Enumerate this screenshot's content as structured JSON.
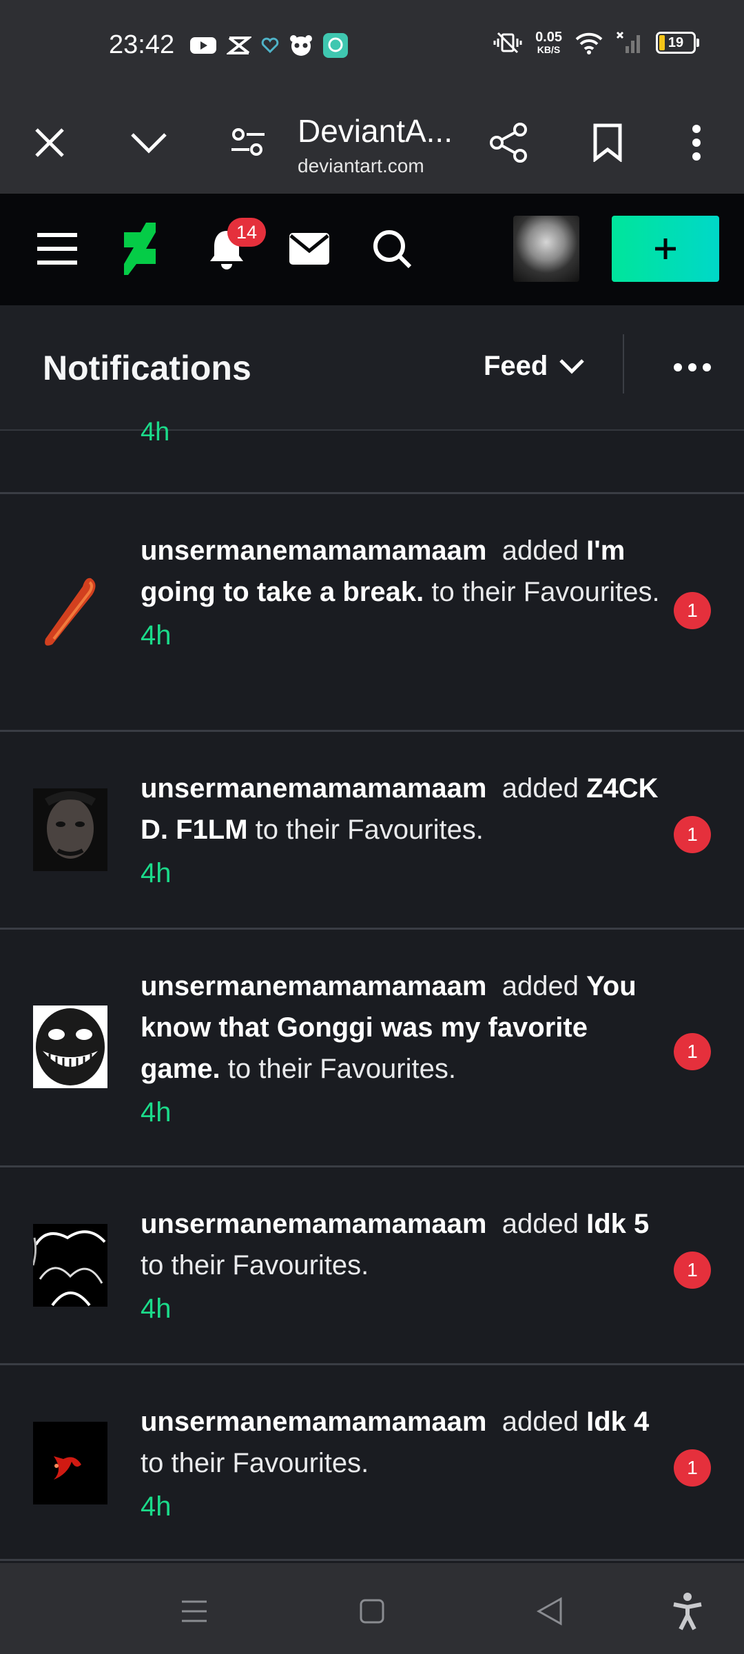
{
  "status_bar": {
    "time": "23:42",
    "net_speed_value": "0.05",
    "net_speed_unit": "KB/S",
    "battery_level": "19"
  },
  "browser": {
    "site_title": "DeviantA...",
    "site_url": "deviantart.com"
  },
  "header": {
    "notification_count": "14"
  },
  "notifications_panel": {
    "title": "Notifications",
    "feed_label": "Feed",
    "partial_time": "4h"
  },
  "items": [
    {
      "user": "unsermanemamamamaam",
      "verb": "added",
      "title": "I'm going to take a break.",
      "suffix": "to their Favourites.",
      "time": "4h",
      "badge": "1"
    },
    {
      "user": "unsermanemamamamaam",
      "verb": "added",
      "title": "Z4CK D. F1LM",
      "suffix": "to their Favourites.",
      "time": "4h",
      "badge": "1"
    },
    {
      "user": "unsermanemamamamaam",
      "verb": "added",
      "title": "You know that Gonggi was my favorite game.",
      "suffix": "to their Favourites.",
      "time": "4h",
      "badge": "1"
    },
    {
      "user": "unsermanemamamamaam",
      "verb": "added",
      "title": "Idk 5",
      "suffix": "to their Favourites.",
      "time": "4h",
      "badge": "1"
    },
    {
      "user": "unsermanemamamamaam",
      "verb": "added",
      "title": "Idk 4",
      "suffix": "to their Favourites.",
      "time": "4h",
      "badge": "1"
    }
  ],
  "colors": {
    "accent_green": "#1bdb8a",
    "badge_red": "#e5303c",
    "background": "#1a1c21"
  }
}
